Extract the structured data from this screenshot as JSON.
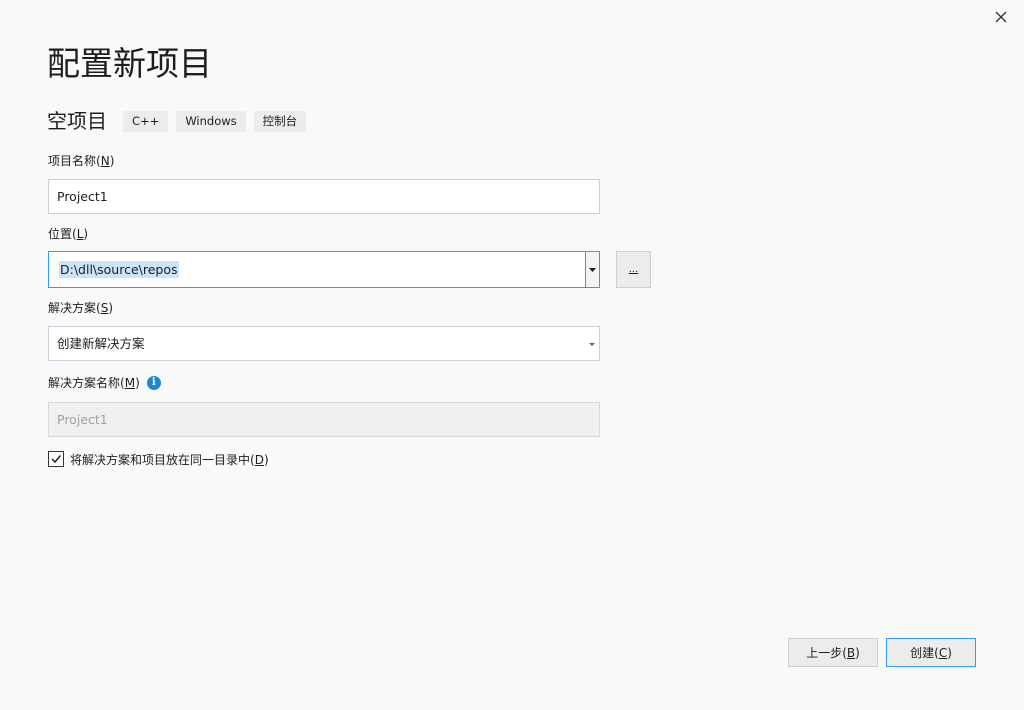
{
  "window": {
    "title": "配置新项目",
    "close_icon": "close-icon"
  },
  "template": {
    "name": "空项目",
    "tags": [
      "C++",
      "Windows",
      "控制台"
    ]
  },
  "project_name": {
    "label": "项目名称",
    "access_key": "N",
    "value": "Project1"
  },
  "location": {
    "label": "位置",
    "access_key": "L",
    "value": "D:\\dll\\source\\repos",
    "browse_label": "..."
  },
  "solution": {
    "label": "解决方案",
    "access_key": "S",
    "selected": "创建新解决方案"
  },
  "solution_name": {
    "label": "解决方案名称",
    "access_key": "M",
    "value": "Project1",
    "info_icon": "info-icon"
  },
  "same_directory": {
    "label": "将解决方案和项目放在同一目录中",
    "access_key": "D",
    "checked": true
  },
  "buttons": {
    "back_label": "上一步",
    "back_key": "B",
    "create_label": "创建",
    "create_key": "C"
  },
  "colors": {
    "accent": "#3399ff",
    "info": "#1e88d8",
    "selection": "#cce4f7",
    "background": "#f9f9f9"
  }
}
